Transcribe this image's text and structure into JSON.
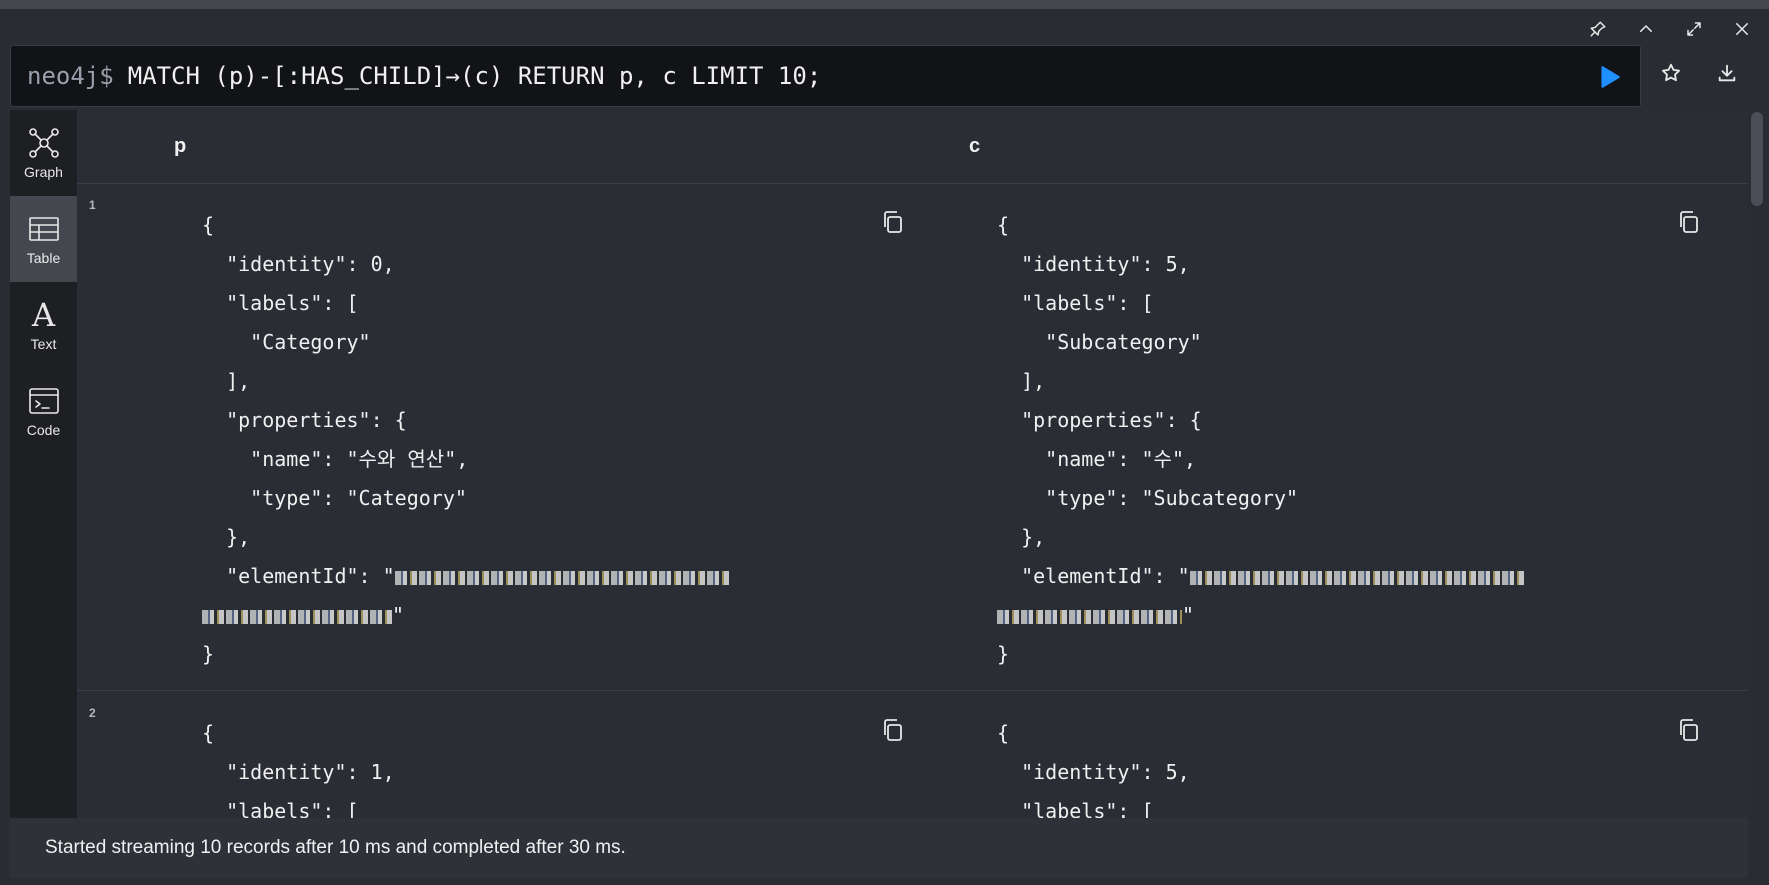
{
  "editor": {
    "prompt": "neo4j$",
    "query": "MATCH (p)-[:HAS_CHILD]→(c) RETURN p, c LIMIT 10;",
    "accent": "#1f8fff"
  },
  "frame_controls": [
    "pin-icon",
    "collapse-icon",
    "fullscreen-icon",
    "close-icon"
  ],
  "view_modes": [
    {
      "id": "graph",
      "label": "Graph",
      "active": false
    },
    {
      "id": "table",
      "label": "Table",
      "active": true
    },
    {
      "id": "text",
      "label": "Text",
      "active": false
    },
    {
      "id": "code",
      "label": "Code",
      "active": false
    }
  ],
  "table": {
    "columns": [
      "p",
      "c"
    ],
    "rows": [
      {
        "index": "1",
        "p": {
          "identity": "0",
          "label": "Category",
          "name": "수와 연산",
          "type": "Category"
        },
        "c": {
          "identity": "5",
          "label": "Subcategory",
          "name": "수",
          "type": "Subcategory"
        }
      },
      {
        "index": "2",
        "p": {
          "identity": "1"
        },
        "c": {
          "identity": "5"
        }
      }
    ]
  },
  "status": {
    "text": "Started streaming 10 records after 10 ms and completed after 30 ms."
  }
}
